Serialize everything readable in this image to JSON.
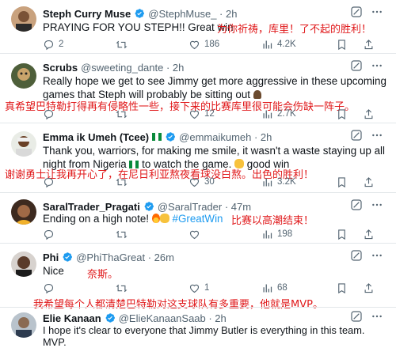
{
  "tweets": [
    {
      "name": "Steph Curry Muse",
      "handle": "@StephMuse_ · 2h",
      "text": [
        "PRAYING FOR YOU STEPH!! Great win"
      ],
      "cn": "为你祈祷，库里！了不起的胜利！",
      "replies": "2",
      "retweets": "",
      "likes": "186",
      "views": "4.2K"
    },
    {
      "name": "Scrubs",
      "handle": "@sweeting_dante · 2h",
      "text": [
        "Really hope we get to see Jimmy get more aggressive in these upcoming",
        "games that Steph will probably be sitting out"
      ],
      "cn": "真希望巴特勒打得再有侵略性一些，接下来的比赛库里很可能会伤缺一阵子。",
      "replies": "",
      "retweets": "",
      "likes": "12",
      "views": "2.7K"
    },
    {
      "name": "Emma ik Umeh (Tcee)",
      "handle": "@emmaikumeh · 2h",
      "text": [
        "Thank you, warriors, for making me smile, it wasn't a waste staying up all",
        "night from Nigeria",
        "to watch the game.",
        "good win"
      ],
      "cn": "谢谢勇士让我再开心了，在尼日利亚熬夜看球没白熬。出色的胜利！",
      "replies": "",
      "retweets": "",
      "likes": "30",
      "views": "3.2K"
    },
    {
      "name": "SaralTrader_Pragati",
      "handle": "@SaralTrader · 47m",
      "text": [
        "Ending on a high note!",
        "#GreatWin"
      ],
      "cn": "比赛以高潮结束！",
      "replies": "",
      "retweets": "",
      "likes": "",
      "views": "198"
    },
    {
      "name": "Phi",
      "handle": "@PhiThaGreat · 26m",
      "text": [
        "Nice"
      ],
      "cn": "奈斯。",
      "replies": "",
      "retweets": "",
      "likes": "1",
      "views": "68"
    },
    {
      "name": "Elie Kanaan",
      "handle": "@ElieKanaanSaab · 2h",
      "text": [
        "I hope it's clear to everyone that Jimmy Butler is everything in this team.",
        "MVP."
      ],
      "cn": "我希望每个人都清楚巴特勒对这支球队有多重要，他就是MVP。",
      "replies": "",
      "retweets": "",
      "likes": "",
      "views": ""
    }
  ],
  "colors": {
    "accent": "#1d9bf0",
    "translation": "#e0191b",
    "muted": "#536471"
  },
  "icons": [
    "verified-badge-icon",
    "grok-icon",
    "more-icon",
    "reply-icon",
    "retweet-icon",
    "like-icon",
    "views-icon",
    "bookmark-icon",
    "share-icon"
  ]
}
